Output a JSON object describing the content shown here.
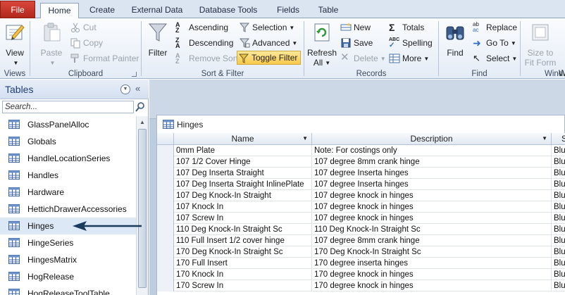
{
  "tabs": [
    {
      "label": "File"
    },
    {
      "label": "Home"
    },
    {
      "label": "Create"
    },
    {
      "label": "External Data"
    },
    {
      "label": "Database Tools"
    },
    {
      "label": "Fields"
    },
    {
      "label": "Table"
    }
  ],
  "ribbon": {
    "views": {
      "label": "Views",
      "view": "View"
    },
    "clipboard": {
      "label": "Clipboard",
      "paste": "Paste",
      "cut": "Cut",
      "copy": "Copy",
      "format_painter": "Format Painter"
    },
    "sort_filter": {
      "label": "Sort & Filter",
      "filter": "Filter",
      "ascending": "Ascending",
      "descending": "Descending",
      "remove_sort": "Remove Sort",
      "selection": "Selection",
      "advanced": "Advanced",
      "toggle_filter": "Toggle Filter"
    },
    "records": {
      "label": "Records",
      "refresh_1": "Refresh",
      "refresh_2": "All",
      "new": "New",
      "save": "Save",
      "delete": "Delete",
      "totals": "Totals",
      "spelling": "Spelling",
      "more": "More"
    },
    "find": {
      "label": "Find",
      "find": "Find",
      "replace": "Replace",
      "goto": "Go To",
      "select": "Select"
    },
    "window": {
      "label": "Wind",
      "size_1": "Size to",
      "size_2": "Fit Form",
      "switch": "W"
    }
  },
  "nav": {
    "title": "Tables",
    "search_placeholder": "Search...",
    "items": [
      {
        "label": "GlassPanelAlloc"
      },
      {
        "label": "Globals"
      },
      {
        "label": "HandleLocationSeries"
      },
      {
        "label": "Handles"
      },
      {
        "label": "Hardware"
      },
      {
        "label": "HettichDrawerAccessories"
      },
      {
        "label": "Hinges"
      },
      {
        "label": "HingeSeries"
      },
      {
        "label": "HingesMatrix"
      },
      {
        "label": "HogRelease"
      },
      {
        "label": "HogReleaseToolTable"
      }
    ]
  },
  "table": {
    "title": "Hinges",
    "columns": [
      "Name",
      "Description",
      "S"
    ],
    "rows": [
      {
        "name": "0mm Plate",
        "description": "Note: For costings only",
        "s": "Blu"
      },
      {
        "name": "107 1/2 Cover Hinge",
        "description": "107 degree 8mm crank hinge",
        "s": "Blu"
      },
      {
        "name": "107 Deg Inserta Straight",
        "description": "107 degree Inserta hinges",
        "s": "Blu"
      },
      {
        "name": "107 Deg Inserta Straight InlinePlate",
        "description": "107 degree Inserta hinges",
        "s": "Blu"
      },
      {
        "name": "107 Deg Knock-In Straight",
        "description": "107 degree knock in hinges",
        "s": "Blu"
      },
      {
        "name": "107 Knock In",
        "description": "107 degree knock in hinges",
        "s": "Blu"
      },
      {
        "name": "107 Screw In",
        "description": "107 degree knock in hinges",
        "s": "Blu"
      },
      {
        "name": "110 Deg Knock-In Straight Sc",
        "description": "110 Deg Knock-In Straight Sc",
        "s": "Blu"
      },
      {
        "name": "110 Full Insert 1/2 cover hinge",
        "description": "107 degree 8mm crank hinge",
        "s": "Blu"
      },
      {
        "name": "170 Deg Knock-In Straight Sc",
        "description": "170 Deg Knock-In Straight Sc",
        "s": "Blu"
      },
      {
        "name": "170 Full Insert",
        "description": "170 degree inserta hinges",
        "s": "Blu"
      },
      {
        "name": "170 Knock In",
        "description": "170 degree knock in hinges",
        "s": "Blu"
      },
      {
        "name": "170 Screw In",
        "description": "170 degree knock in hinges",
        "s": "Blu"
      }
    ]
  },
  "colors": {
    "accent": "#1f3f7a",
    "file_tab": "#c0382b",
    "toggle_highlight": "#f8c94a",
    "annotation_arrow": "#1b3a5c"
  }
}
